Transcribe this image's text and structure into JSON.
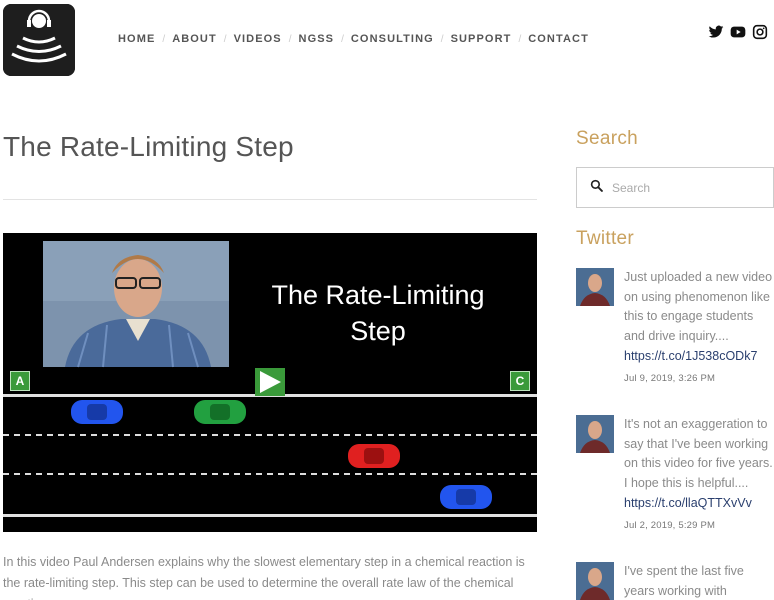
{
  "header": {
    "nav": [
      "HOME",
      "ABOUT",
      "VIDEOS",
      "NGSS",
      "CONSULTING",
      "SUPPORT",
      "CONTACT"
    ],
    "social": [
      "twitter-icon",
      "youtube-icon",
      "instagram-icon"
    ]
  },
  "main": {
    "title": "The Rate-Limiting Step",
    "video": {
      "title_line1": "The Rate-Limiting",
      "title_line2": "Step",
      "marker_a": "A",
      "marker_c": "C",
      "play_icon": "play-icon"
    },
    "description": "In this video Paul Andersen explains why the slowest elementary step in a chemical reaction is the rate-limiting step. This step can be used to determine the overall rate law of the chemical reaction."
  },
  "sidebar": {
    "search_heading": "Search",
    "search_placeholder": "Search",
    "twitter_heading": "Twitter",
    "tweets": [
      {
        "text": "Just uploaded a new video on using phenomenon like this to engage students and drive inquiry....",
        "link": "https://t.co/1J538cODk7",
        "date": "Jul 9, 2019, 3:26 PM"
      },
      {
        "text": "It's not an exaggeration to say that I've been working on this video for five years. I hope this is helpful....",
        "link": "https://t.co/llaQTTXvVv",
        "date": "Jul 2, 2019, 5:29 PM"
      },
      {
        "text": "I've spent the last five years working with",
        "link": "",
        "date": ""
      }
    ]
  },
  "colors": {
    "accent": "#c9a15e",
    "link": "#2a3f6e",
    "car_blue": "#2255ee",
    "car_green": "#22a040",
    "car_red": "#e02020",
    "marker_green": "#3a9a3a"
  }
}
